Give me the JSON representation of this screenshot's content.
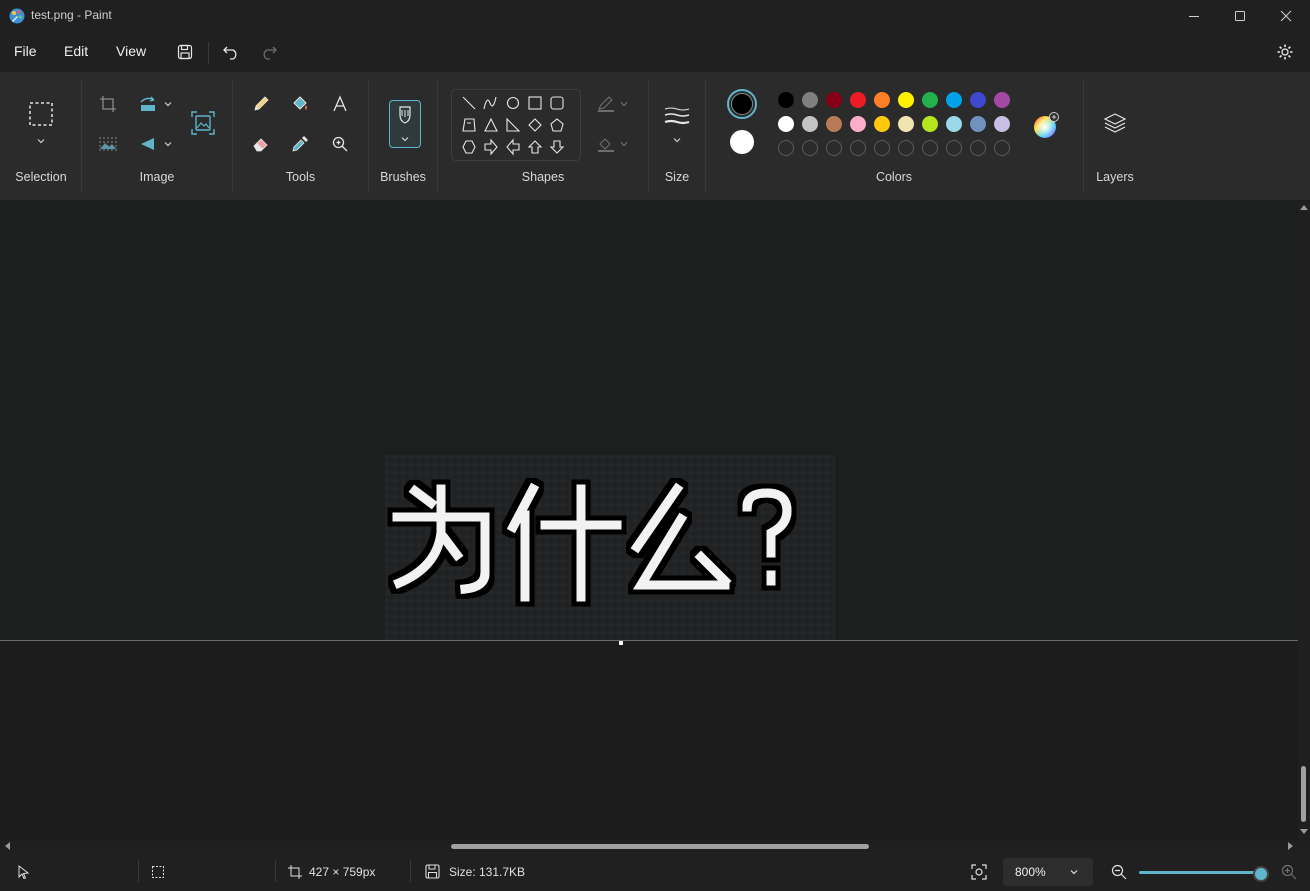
{
  "window": {
    "title": "test.png - Paint",
    "controls": [
      "minimize-icon",
      "maximize-icon",
      "close-icon"
    ]
  },
  "menu": {
    "items": [
      "File",
      "Edit",
      "View"
    ],
    "quick_actions": [
      "save-icon",
      "undo-icon",
      "redo-icon"
    ]
  },
  "ribbon": {
    "groups": {
      "selection": "Selection",
      "image": "Image",
      "tools": "Tools",
      "brushes": "Brushes",
      "shapes": "Shapes",
      "size": "Size",
      "colors": "Colors",
      "layers": "Layers"
    },
    "primary_color": "#000000",
    "secondary_color": "#ffffff",
    "palette_row1": [
      "#000000",
      "#7f7f7f",
      "#880015",
      "#ed1c24",
      "#ff7f27",
      "#fff200",
      "#22b14c",
      "#00a2e8",
      "#3f48cc",
      "#a349a4"
    ],
    "palette_row2": [
      "#ffffff",
      "#c3c3c3",
      "#b97a57",
      "#ffaec9",
      "#ffc90e",
      "#efe4b0",
      "#b5e61d",
      "#99d9ea",
      "#7092be",
      "#c8bfe7"
    ],
    "accent": "#5fb5c9"
  },
  "canvas": {
    "image_text": "为什么?"
  },
  "status": {
    "dimensions": "427 × 759px",
    "size": "Size: 131.7KB",
    "zoom": "800%"
  }
}
